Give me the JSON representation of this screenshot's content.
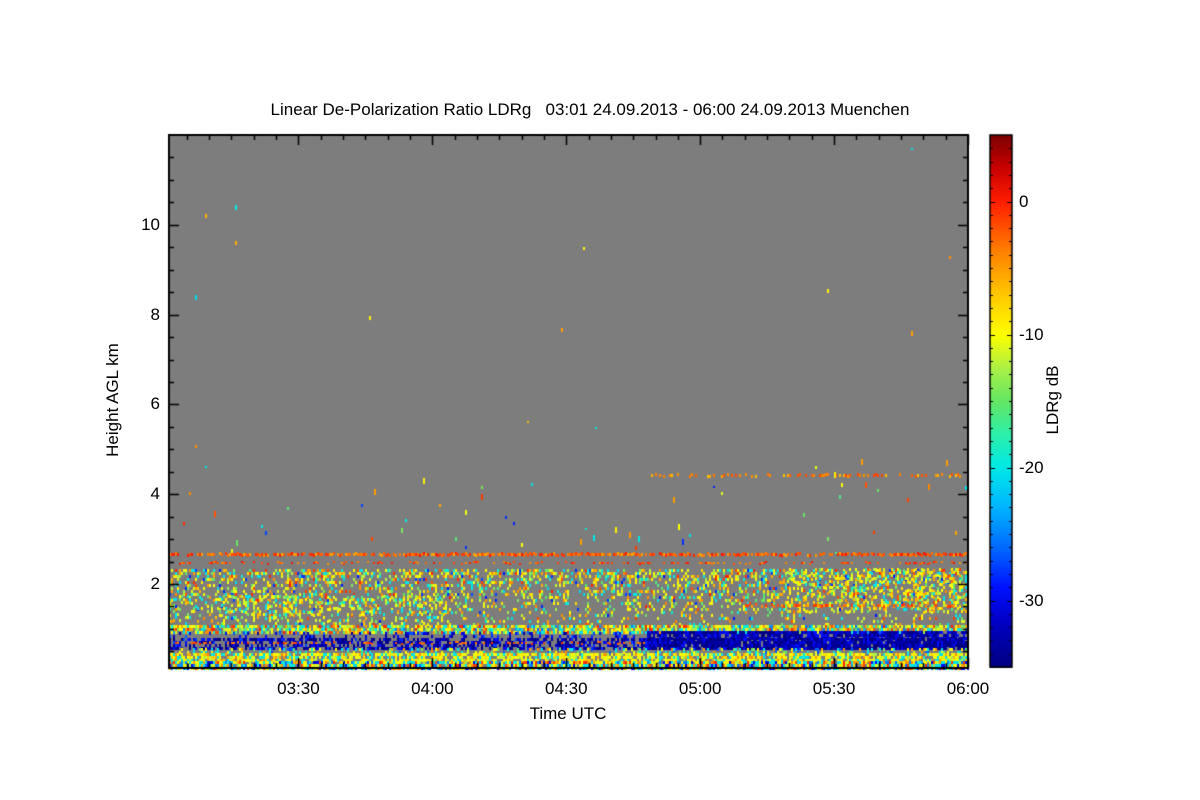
{
  "title": "Linear De-Polarization Ratio LDRg   03:01 24.09.2013 - 06:00 24.09.2013 Muenchen",
  "axes": {
    "x_label": "Time UTC",
    "y_label": "Height AGL km",
    "x_major_ticks": [
      {
        "minute": 30,
        "label": "03:30"
      },
      {
        "minute": 60,
        "label": "04:00"
      },
      {
        "minute": 90,
        "label": "04:30"
      },
      {
        "minute": 120,
        "label": "05:00"
      },
      {
        "minute": 150,
        "label": "05:30"
      },
      {
        "minute": 180,
        "label": "06:00"
      }
    ],
    "x_minor_step_min": 5,
    "y_major_ticks": [
      {
        "km": 2,
        "label": "2"
      },
      {
        "km": 4,
        "label": "4"
      },
      {
        "km": 6,
        "label": "6"
      },
      {
        "km": 8,
        "label": "8"
      },
      {
        "km": 10,
        "label": "10"
      }
    ],
    "y_minor_step_km": 0.5
  },
  "colorbar": {
    "label": "LDRg dB",
    "ticks": [
      {
        "db": 0,
        "label": "0"
      },
      {
        "db": -10,
        "label": "-10"
      },
      {
        "db": -20,
        "label": "-20"
      },
      {
        "db": -30,
        "label": "-30"
      }
    ],
    "minor_step_db": 1
  },
  "chart_data": {
    "type": "heatmap",
    "station": "Muenchen",
    "time_start": "03:01 24.09.2013",
    "time_end": "06:00 24.09.2013",
    "x_start_min": 1,
    "x_end_min": 180,
    "y_min_km": 0.13,
    "y_max_km": 12.0,
    "scale_min_db": -35,
    "scale_max_db": 5,
    "no_data_color": "#7d7d7d",
    "seed": 42,
    "palette": [
      [
        0.0,
        "#000080"
      ],
      [
        0.09,
        "#0000c8"
      ],
      [
        0.15,
        "#0010ff"
      ],
      [
        0.22,
        "#0064ff"
      ],
      [
        0.3,
        "#00b4ff"
      ],
      [
        0.375,
        "#00e8e8"
      ],
      [
        0.44,
        "#2ef0a8"
      ],
      [
        0.5,
        "#64e664"
      ],
      [
        0.56,
        "#a8f048"
      ],
      [
        0.625,
        "#ffff00"
      ],
      [
        0.7,
        "#ffc800"
      ],
      [
        0.78,
        "#ff8200"
      ],
      [
        0.875,
        "#ff1e00"
      ],
      [
        0.94,
        "#c80000"
      ],
      [
        1.0,
        "#7d0000"
      ]
    ],
    "bands": [
      {
        "name": "speckle-field",
        "m0": 1,
        "m1": 180,
        "h0": 0.98,
        "h1": 2.33,
        "cov": [
          0.04,
          0.45
        ],
        "values": [
          -10,
          -12,
          -20,
          -15,
          -5,
          -1,
          -28,
          -8
        ],
        "weights": [
          22,
          10,
          18,
          12,
          14,
          8,
          6,
          10
        ]
      },
      {
        "name": "left-dense-patch",
        "m0": 1,
        "m1": 63,
        "h0": 0.98,
        "h1": 1.75,
        "cov": [
          0.12,
          0.35
        ],
        "values": [
          -10,
          -20,
          -12,
          -15,
          -6
        ],
        "weights": [
          25,
          20,
          15,
          12,
          10
        ]
      },
      {
        "name": "right-yellow-patch",
        "m0": 139,
        "m1": 180,
        "h0": 1.35,
        "h1": 2.35,
        "cov": [
          0.28,
          0.28
        ],
        "values": [
          -10,
          -8,
          -12,
          -6,
          -15,
          -20,
          -2
        ],
        "weights": [
          30,
          15,
          12,
          10,
          8,
          8,
          6
        ]
      },
      {
        "name": "dense-row-1km",
        "m0": 1,
        "m1": 180,
        "h0": 0.93,
        "h1": 1.09,
        "cov": [
          0.75,
          0.85
        ],
        "values": [
          -10,
          -20,
          -5,
          -15,
          -12,
          -25,
          -1
        ],
        "weights": [
          25,
          20,
          15,
          12,
          10,
          8,
          10
        ]
      },
      {
        "name": "blue-dots-left",
        "m0": 1,
        "m1": 108,
        "h0": 0.8,
        "h1": 0.93,
        "cov": [
          0.18,
          0.25
        ],
        "values": [
          -30,
          -33,
          -27
        ],
        "weights": [
          40,
          35,
          25
        ]
      },
      {
        "name": "navy-band-right-upper",
        "m0": 108,
        "m1": 180,
        "h0": 0.78,
        "h1": 0.95,
        "cov": [
          0.8,
          0.9
        ],
        "values": [
          -33,
          -30,
          -35
        ],
        "weights": [
          40,
          35,
          25
        ]
      },
      {
        "name": "navy-band-left",
        "m0": 1,
        "m1": 108,
        "h0": 0.55,
        "h1": 0.8,
        "cov": [
          0.55,
          0.65
        ],
        "values": [
          -33,
          -35,
          -30,
          -28
        ],
        "weights": [
          35,
          30,
          25,
          10
        ]
      },
      {
        "name": "navy-band-right",
        "m0": 108,
        "m1": 180,
        "h0": 0.55,
        "h1": 0.8,
        "cov": [
          0.92,
          0.95
        ],
        "values": [
          -33,
          -35,
          -30
        ],
        "weights": [
          40,
          35,
          25
        ]
      },
      {
        "name": "gap-band",
        "m0": 1,
        "m1": 180,
        "h0": 0.46,
        "h1": 0.58,
        "cov": [
          0.3,
          0.35
        ],
        "values": [
          -20,
          -10,
          -15,
          -27,
          -5
        ],
        "weights": [
          30,
          25,
          15,
          15,
          15
        ]
      },
      {
        "name": "yellow-band",
        "m0": 1,
        "m1": 180,
        "h0": 0.29,
        "h1": 0.46,
        "cov": [
          0.75,
          0.8
        ],
        "values": [
          -10,
          -8,
          -12,
          -5,
          -20
        ],
        "weights": [
          40,
          15,
          12,
          13,
          20
        ]
      },
      {
        "name": "bottom-band",
        "m0": 1,
        "m1": 180,
        "h0": 0.13,
        "h1": 0.29,
        "cov": [
          0.9,
          0.92
        ],
        "values": [
          -20,
          -10,
          -30,
          -1,
          -5,
          -12,
          -25
        ],
        "weights": [
          22,
          20,
          12,
          10,
          12,
          12,
          12
        ]
      },
      {
        "name": "sparse-mid",
        "m0": 1,
        "m1": 180,
        "h0": 2.55,
        "h1": 4.25,
        "cov": [
          0.002,
          0.004
        ],
        "values": [
          -10,
          -5,
          -20,
          -1,
          -15,
          -28
        ],
        "weights": [
          17,
          17,
          17,
          17,
          16,
          16
        ]
      },
      {
        "name": "sparse-high",
        "m0": 1,
        "m1": 180,
        "h0": 4.5,
        "h1": 11.9,
        "cov": [
          0.0002,
          0.0002
        ],
        "values": [
          -10,
          -20,
          -5
        ],
        "weights": [
          34,
          33,
          33
        ]
      }
    ],
    "lines": [
      {
        "name": "aerosol-top-line",
        "h": 2.67,
        "m0": 1,
        "m1": 180,
        "cov": 0.8,
        "values": [
          -3,
          -1,
          -5,
          0
        ],
        "weights": [
          40,
          25,
          20,
          15
        ],
        "th": 3
      },
      {
        "name": "second-dot-line",
        "h": 2.47,
        "m0": 1,
        "m1": 180,
        "cov": 0.38,
        "values": [
          -2,
          0,
          -4
        ],
        "weights": [
          40,
          30,
          30
        ],
        "th": 2
      },
      {
        "name": "elevated-layer",
        "h": 4.43,
        "m0": 108,
        "m1": 180,
        "cov": 0.42,
        "values": [
          -4,
          -2,
          -6
        ],
        "weights": [
          40,
          30,
          30
        ],
        "th": 3
      },
      {
        "name": "orange-row-in-navy",
        "h": 0.69,
        "m0": 1,
        "m1": 108,
        "cov": 0.3,
        "values": [
          -3,
          -1
        ],
        "weights": [
          60,
          40
        ],
        "th": 2
      },
      {
        "name": "red-streak-right",
        "h": 1.53,
        "m0": 130,
        "m1": 180,
        "cov": 0.5,
        "values": [
          -3,
          -1,
          -5
        ],
        "weights": [
          40,
          30,
          30
        ],
        "th": 3
      }
    ],
    "points": [
      {
        "m": 58,
        "h": 4.3,
        "v": -9
      },
      {
        "m": 47,
        "h": 4.05,
        "v": -5
      },
      {
        "m": 71,
        "h": 3.94,
        "v": -1
      },
      {
        "m": 11,
        "h": 3.56,
        "v": -2
      },
      {
        "m": 114,
        "h": 3.87,
        "v": -5
      },
      {
        "m": 101,
        "h": 3.21,
        "v": -9
      },
      {
        "m": 104,
        "h": 3.1,
        "v": -5
      },
      {
        "m": 96,
        "h": 3.03,
        "v": -20
      },
      {
        "m": 106,
        "h": 3.0,
        "v": -20
      },
      {
        "m": 93,
        "h": 2.94,
        "v": -5
      },
      {
        "m": 115,
        "h": 3.26,
        "v": -10
      },
      {
        "m": 116,
        "h": 2.94,
        "v": -28
      },
      {
        "m": 16,
        "h": 2.92,
        "v": -15
      },
      {
        "m": 156,
        "h": 4.72,
        "v": -5
      },
      {
        "m": 175,
        "h": 4.7,
        "v": -5
      },
      {
        "m": 150,
        "h": 4.43,
        "v": -9
      },
      {
        "m": 157,
        "h": 4.2,
        "v": -2
      },
      {
        "m": 171,
        "h": 4.16,
        "v": -4
      }
    ]
  }
}
